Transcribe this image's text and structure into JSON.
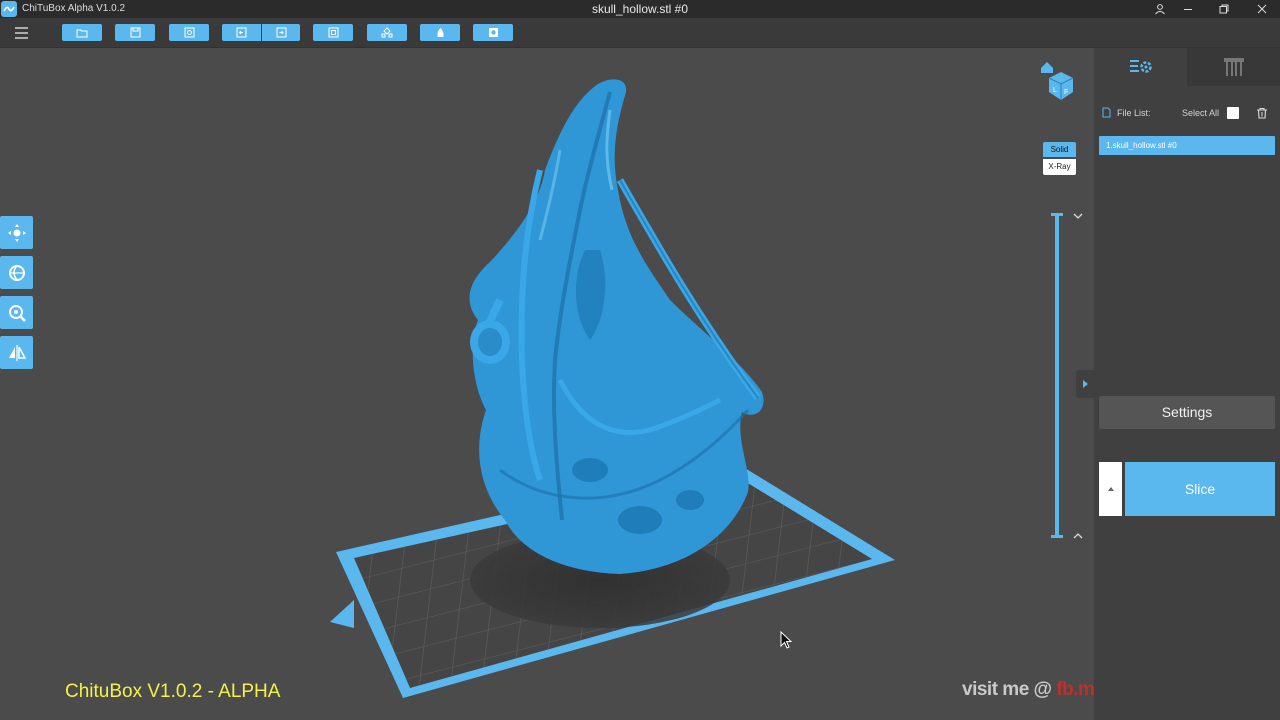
{
  "app": {
    "name": "ChiTuBox Alpha V1.0.2",
    "document_title": "skull_hollow.stl #0"
  },
  "window_controls": [
    "user-icon",
    "minimize-icon",
    "restore-icon",
    "close-icon"
  ],
  "toolbar": {
    "menu_icon": "hamburger-menu-icon",
    "buttons": [
      {
        "name": "open-file-button",
        "icon": "folder-icon"
      },
      {
        "name": "save-button",
        "icon": "save-icon"
      },
      {
        "name": "screenshot-button",
        "icon": "camera-icon"
      },
      {
        "name": "undo-button",
        "icon": "undo-icon"
      },
      {
        "name": "redo-button",
        "icon": "redo-icon"
      },
      {
        "name": "copy-button",
        "icon": "copy-icon"
      },
      {
        "name": "arrange-button",
        "icon": "arrange-icon"
      },
      {
        "name": "hollow-button",
        "icon": "hollow-icon"
      },
      {
        "name": "dig-hole-button",
        "icon": "hole-icon"
      }
    ]
  },
  "left_tools": [
    {
      "name": "move-tool",
      "icon": "move-icon"
    },
    {
      "name": "rotate-tool",
      "icon": "rotate-icon"
    },
    {
      "name": "scale-tool",
      "icon": "scale-icon"
    },
    {
      "name": "mirror-tool",
      "icon": "mirror-icon"
    }
  ],
  "view": {
    "solid_label": "Solid",
    "xray_label": "X-Ray",
    "selected_mode": "Solid",
    "navcube_icon": "view-cube-icon",
    "home_icon": "home-icon"
  },
  "right_panel": {
    "tabs": [
      {
        "name": "tab-settings",
        "icon": "settings-list-icon",
        "active": true
      },
      {
        "name": "tab-supports",
        "icon": "supports-icon",
        "active": false
      }
    ],
    "file_list_label": "File List:",
    "select_all_label": "Select All",
    "files": [
      "1.skull_hollow.stl #0"
    ],
    "settings_label": "Settings",
    "slice_label": "Slice"
  },
  "overlay": {
    "caption": "ChituBox V1.0.2 - ALPHA",
    "visit_prefix": "visit me @ ",
    "visit_link": "fb.me/CustomModelsJC"
  },
  "colors": {
    "accent": "#5ab8ee",
    "model": "#2f97d6",
    "background": "#4b4b4b"
  }
}
